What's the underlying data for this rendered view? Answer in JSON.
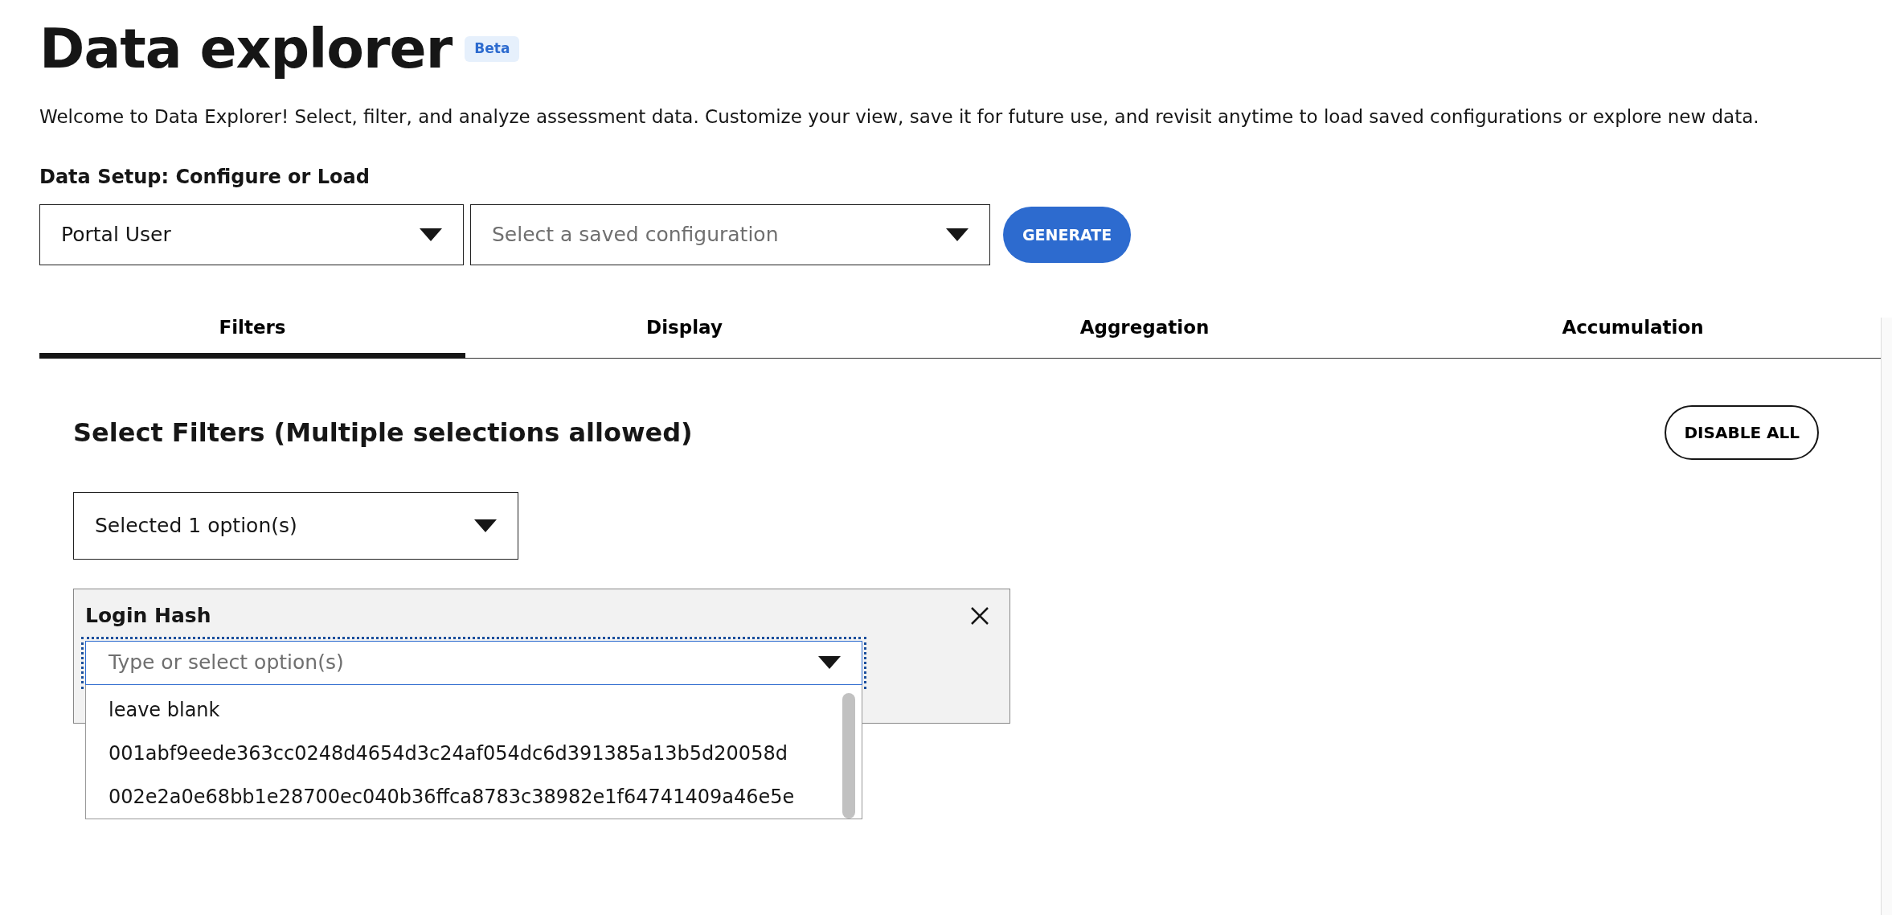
{
  "header": {
    "title": "Data explorer",
    "badge": "Beta",
    "intro": "Welcome to Data Explorer! Select, filter, and analyze assessment data. Customize your view, save it for future use, and revisit anytime to load saved configurations or explore new data."
  },
  "setup": {
    "label": "Data Setup: Configure or Load",
    "source_select": {
      "value": "Portal User"
    },
    "config_select": {
      "placeholder": "Select a saved configuration"
    },
    "generate_button": "GENERATE"
  },
  "tabs": [
    {
      "label": "Filters",
      "selected": true
    },
    {
      "label": "Display",
      "selected": false
    },
    {
      "label": "Aggregation",
      "selected": false
    },
    {
      "label": "Accumulation",
      "selected": false
    }
  ],
  "filters": {
    "heading": "Select Filters (Multiple selections allowed)",
    "disable_all_button": "DISABLE ALL",
    "filter_select": {
      "value": "Selected 1 option(s)"
    },
    "panels": [
      {
        "title": "Login Hash",
        "combobox": {
          "placeholder": "Type or select option(s)",
          "expanded": true
        },
        "options": [
          "leave blank",
          "001abf9eede363cc0248d4654d3c24af054dc6d391385a13b5d20058d",
          "002e2a0e68bb1e28700ec040b36ffca8783c38982e1f64741409a46e5e"
        ]
      }
    ]
  }
}
